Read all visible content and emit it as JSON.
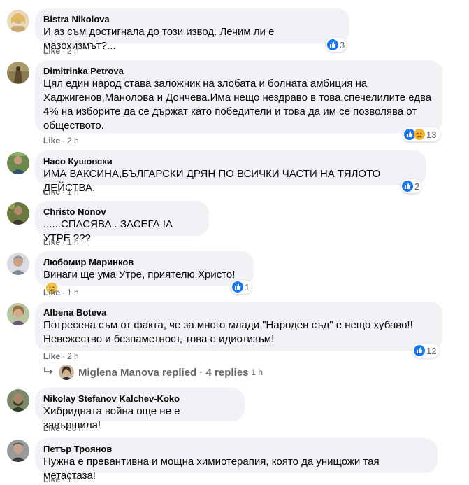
{
  "like_label": "Like",
  "comments": [
    {
      "author": "Bistra Nikolova",
      "text": "И аз съм достигнала до този извод. Лечим ли е мазохизмът?...",
      "time": "2 h",
      "reactions": "3"
    },
    {
      "author": "Dimitrinka Petrova",
      "text": "Цял един народ става заложник на злобата и болната амбиция на Хаджигенов,Манолова и Дончева.Има нещо нездраво в това,спечелилите едва 4% на изборите да се държат като победители и това да им се позволява от обществото.",
      "time": "2 h",
      "reactions": "13"
    },
    {
      "author": "Насо Кушовски",
      "text": "ИМА ВАКСИНА,БЪЛГАРСКИ ДРЯН ПО ВСИЧКИ ЧАСТИ НА ТЯЛОТО ДЕЙСТВА.",
      "time": "1 h",
      "reactions": "2"
    },
    {
      "author": "Christo Nonov",
      "text": "......СПАСЯВА.. ЗАСЕГА !А УТРЕ ???",
      "time": "1 h"
    },
    {
      "author": "Любомир Маринков",
      "text": "Винаги ще ума Утре, приятелю Христо!",
      "time": "1 h",
      "reactions": "1"
    },
    {
      "author": "Albena Boteva",
      "text": "Потресена съм от факта, че за много млади \"Народен съд\" е нещо хубаво!!\nНевежество и безпаметност, това е идиотизъм!",
      "time": "2 h",
      "reactions": "12"
    },
    {
      "author": "Nikolay Stefanov Kalchev-Koko",
      "text": "Хибридната война още не е завършила!",
      "time": "56 m"
    },
    {
      "author": "Петър Троянов",
      "text": "Нужна е превантивна и мощна химиотерапия, която да унищожи тая метастаза!",
      "time": "1 h"
    }
  ],
  "replies_line": {
    "text": "Miglena Manova replied · 4 replies",
    "time": "1 h"
  },
  "colors": {
    "like_blue": "#1877f2",
    "haha_yellow": "#f7b125",
    "bubble": "#f0f2f5",
    "meta_gray": "#65676b"
  }
}
